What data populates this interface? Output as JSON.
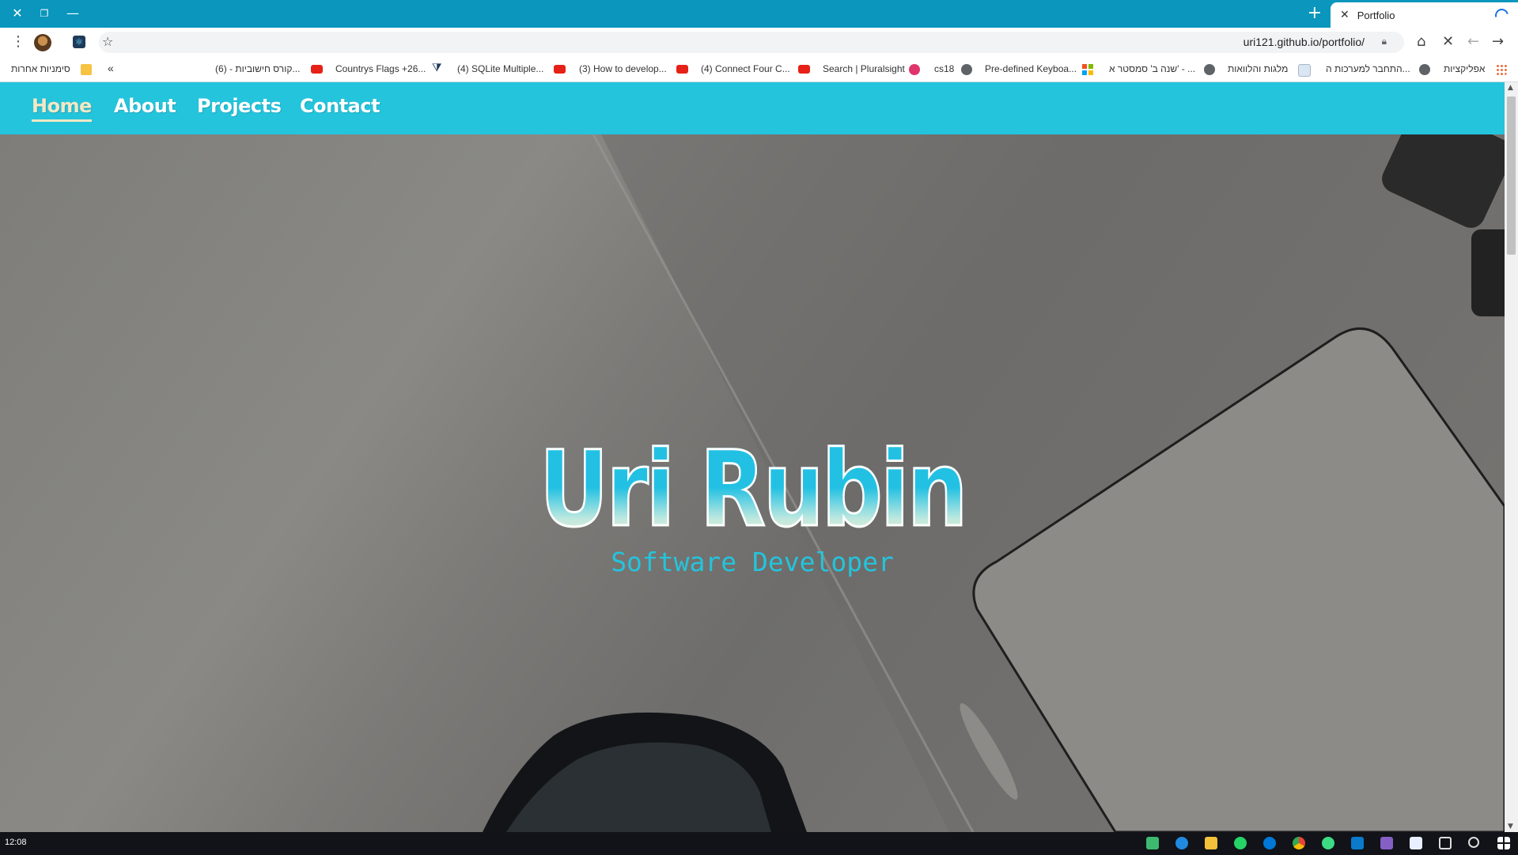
{
  "browser": {
    "tab_title": "Portfolio",
    "url": "uri121.github.io/portfolio/",
    "icons": [
      "close-icon",
      "restore-icon",
      "minimize-icon",
      "new-tab-icon",
      "menu-icon",
      "star-icon",
      "home-icon",
      "stop-icon",
      "back-icon",
      "forward-icon",
      "lock-icon"
    ]
  },
  "bookmarks": {
    "other_bookmarks": "סימניות אחרות",
    "overflow": "«",
    "items": [
      "קורס חישוביות - (6)...",
      "Countrys Flags +26...",
      "(4) SQLite Multiple...",
      "(3) How to develop...",
      "(4) Connect Four C...",
      "Search | Pluralsight",
      "cs18",
      "Pre-defined Keyboa...",
      "שנה ב' סמסטר א' - ...",
      "מלגות והלוואות",
      "התחבר למערכות ה...",
      "אפליקציות"
    ]
  },
  "nav": {
    "home": "Home",
    "about": "About",
    "projects": "Projects",
    "contact": "Contact"
  },
  "hero": {
    "title": "Uri Rubin",
    "subtitle": "Software Developer"
  },
  "taskbar": {
    "clock": "12:08"
  },
  "colors": {
    "accent": "#24c4dc",
    "tabstrip": "#0a96bd",
    "active_nav": "#f3e8c4"
  }
}
